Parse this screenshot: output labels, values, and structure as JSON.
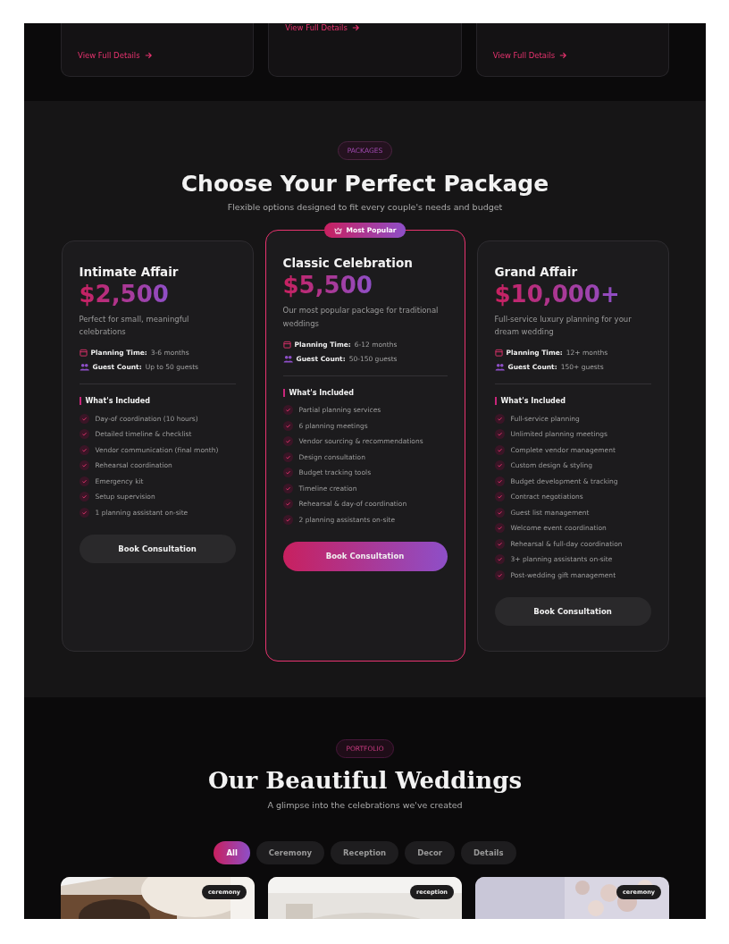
{
  "services": {
    "links": [
      {
        "label": "View Full Details"
      },
      {
        "label": "View Full Details"
      },
      {
        "label": "View Full Details"
      }
    ]
  },
  "packages": {
    "badge": "PACKAGES",
    "title": "Choose Your Perfect Package",
    "subtitle": "Flexible options designed to fit every couple's needs and budget",
    "plans": [
      {
        "name": "Intimate Affair",
        "price": "$2,500",
        "description": "Perfect for small, meaningful celebrations",
        "featured": false,
        "planning_label": "Planning Time:",
        "planning_value": "3-6 months",
        "guest_label": "Guest Count:",
        "guest_value": "Up to 50 guests",
        "included_title": "What's Included",
        "features": [
          "Day-of coordination (10 hours)",
          "Detailed timeline & checklist",
          "Vendor communication (final month)",
          "Rehearsal coordination",
          "Emergency kit",
          "Setup supervision",
          "1 planning assistant on-site"
        ],
        "button": "Book Consultation"
      },
      {
        "name": "Classic Celebration",
        "badge": "Most Popular",
        "price": "$5,500",
        "description": "Our most popular package for traditional weddings",
        "featured": true,
        "planning_label": "Planning Time:",
        "planning_value": "6-12 months",
        "guest_label": "Guest Count:",
        "guest_value": "50-150 guests",
        "included_title": "What's Included",
        "features": [
          "Partial planning services",
          "6 planning meetings",
          "Vendor sourcing & recommendations",
          "Design consultation",
          "Budget tracking tools",
          "Timeline creation",
          "Rehearsal & day-of coordination",
          "2 planning assistants on-site"
        ],
        "button": "Book Consultation"
      },
      {
        "name": "Grand Affair",
        "price": "$10,000+",
        "description": "Full-service luxury planning for your dream wedding",
        "featured": false,
        "planning_label": "Planning Time:",
        "planning_value": "12+ months",
        "guest_label": "Guest Count:",
        "guest_value": "150+ guests",
        "included_title": "What's Included",
        "features": [
          "Full-service planning",
          "Unlimited planning meetings",
          "Complete vendor management",
          "Custom design & styling",
          "Budget development & tracking",
          "Contract negotiations",
          "Guest list management",
          "Welcome event coordination",
          "Rehearsal & full-day coordination",
          "3+ planning assistants on-site",
          "Post-wedding gift management"
        ],
        "button": "Book Consultation"
      }
    ]
  },
  "portfolio": {
    "badge": "PORTFOLIO",
    "title": "Our Beautiful Weddings",
    "subtitle": "A glimpse into the celebrations we've created",
    "filters": [
      {
        "label": "All",
        "selected": true
      },
      {
        "label": "Ceremony",
        "selected": false
      },
      {
        "label": "Reception",
        "selected": false
      },
      {
        "label": "Decor",
        "selected": false
      },
      {
        "label": "Details",
        "selected": false
      }
    ],
    "photos": [
      {
        "kind": "picture",
        "tag": "ceremony"
      },
      {
        "kind": "picture",
        "tag": "reception"
      },
      {
        "kind": "picture",
        "tag": "ceremony"
      }
    ]
  }
}
